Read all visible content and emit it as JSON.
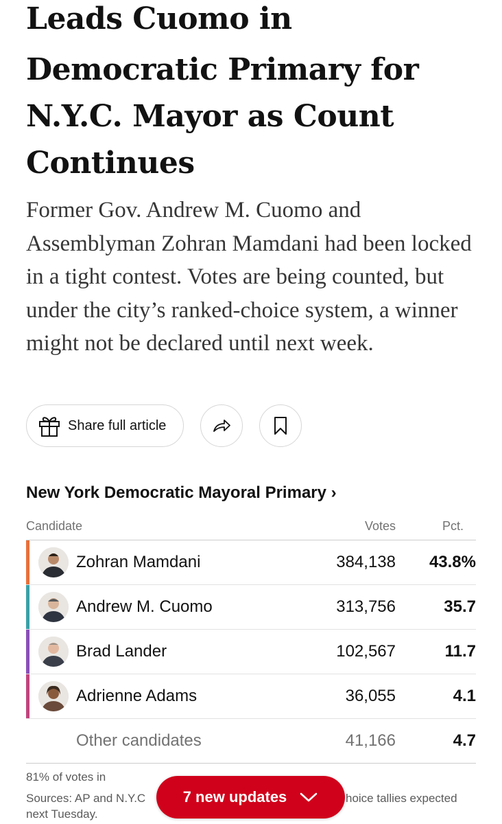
{
  "article": {
    "headline_lines": [
      "Leads Cuomo in",
      "Democratic Primary for",
      "N.Y.C. Mayor as Count",
      "Continues"
    ],
    "summary": "Former Gov. Andrew M. Cuomo and Assemblyman Zohran Mamdani had been locked in a tight contest. Votes are being counted, but under the city’s ranked-choice system, a winner might not be declared until next week."
  },
  "actions": {
    "share_label": "Share full article",
    "gift_icon": "gift-icon",
    "share_icon": "share-arrow-icon",
    "save_icon": "bookmark-icon"
  },
  "results": {
    "title": "New York Democratic Mayoral Primary ›",
    "columns": {
      "candidate": "Candidate",
      "votes": "Votes",
      "pct": "Pct."
    },
    "rows": [
      {
        "name": "Zohran Mamdani",
        "votes": "384,138",
        "pct": "43.8%",
        "color": "#e8703a"
      },
      {
        "name": "Andrew M. Cuomo",
        "votes": "313,756",
        "pct": "35.7",
        "color": "#3aa0a8"
      },
      {
        "name": "Brad Lander",
        "votes": "102,567",
        "pct": "11.7",
        "color": "#8a4fb8"
      },
      {
        "name": "Adrienne Adams",
        "votes": "36,055",
        "pct": "4.1",
        "color": "#c0457e"
      },
      {
        "name": "Other candidates",
        "votes": "41,166",
        "pct": "4.7"
      }
    ],
    "reporting": "81% of votes in",
    "sources_left": "Sources: AP and N.Y.C",
    "sources_right": "hoice tallies expected",
    "sources_line2": "next Tuesday."
  },
  "updates_pill": {
    "label": "7 new updates",
    "icon": "chevron-down-icon",
    "color": "#d0021b"
  }
}
